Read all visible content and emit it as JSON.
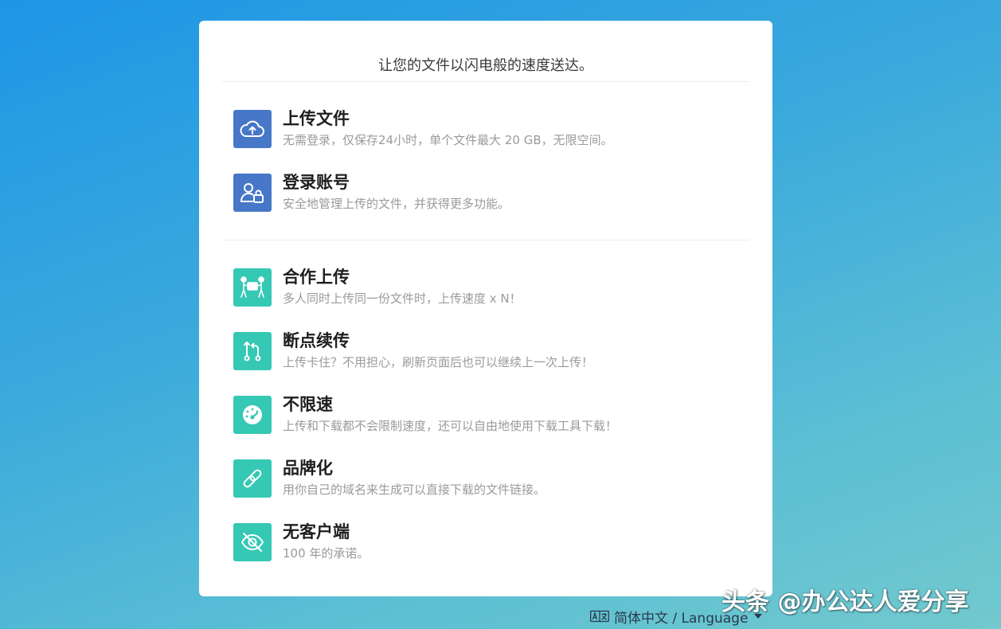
{
  "tagline": "让您的文件以闪电般的速度送达。",
  "features": [
    {
      "title": "上传文件",
      "desc": "无需登录，仅保存24小时，单个文件最大 20 GB，无限空间。",
      "icon": "cloud-upload-icon"
    },
    {
      "title": "登录账号",
      "desc": "安全地管理上传的文件，并获得更多功能。",
      "icon": "user-lock-icon"
    },
    {
      "title": "合作上传",
      "desc": "多人同时上传同一份文件时，上传速度 x N！",
      "icon": "people-carry-icon"
    },
    {
      "title": "断点续传",
      "desc": "上传卡住？不用担心，刷新页面后也可以继续上一次上传！",
      "icon": "resume-arrows-icon"
    },
    {
      "title": "不限速",
      "desc": "上传和下载都不会限制速度，还可以自由地使用下载工具下载！",
      "icon": "speedometer-icon"
    },
    {
      "title": "品牌化",
      "desc": "用你自己的域名来生成可以直接下载的文件链接。",
      "icon": "link-icon"
    },
    {
      "title": "无客户端",
      "desc": "100 年的承诺。",
      "icon": "eye-slash-icon"
    }
  ],
  "language": {
    "label": "简体中文 / Language",
    "icon": "translate-icon"
  },
  "watermark": "头条 @办公达人爱分享",
  "colors": {
    "blue_icon": "#4677c8",
    "teal_icon": "#35c8b4"
  }
}
